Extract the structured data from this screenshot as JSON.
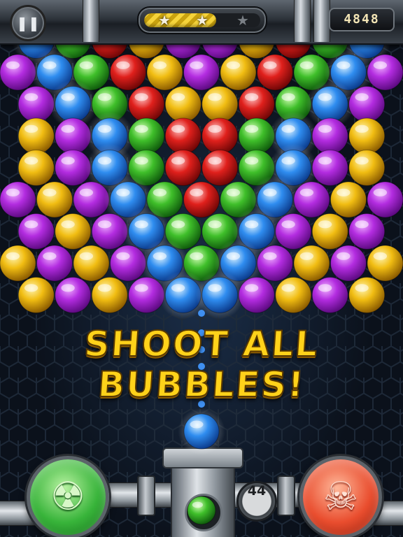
{
  "hud": {
    "pause_icon": "pause-icon",
    "pause_glyph": "❚❚",
    "stars": [
      "★",
      "★",
      "★"
    ],
    "stars_earned": 2,
    "progress": 0.62,
    "score": "4848"
  },
  "headline": {
    "line1": "SHOOT ALL",
    "line2": "BUBBLES!"
  },
  "launcher": {
    "current_bubble_color": "blue",
    "next_bubble_color": "green",
    "shots_left": "44"
  },
  "powerups": {
    "left": {
      "icon": "radiation-icon",
      "glyph": "☢",
      "color": "#3fb43c"
    },
    "right": {
      "icon": "skull-icon",
      "glyph": "☠",
      "color": "#e84a2c"
    }
  },
  "colors": {
    "purple": [
      "#f0b0ff",
      "#b32ce0",
      "#5c0a80"
    ],
    "blue": [
      "#dff4ff",
      "#2f8df0",
      "#0b3b8c"
    ],
    "green": [
      "#d6ffb8",
      "#3fbf2a",
      "#0f5a0c"
    ],
    "red": [
      "#ffc2c2",
      "#e0201c",
      "#6e0606"
    ],
    "yellow": [
      "#fff4b0",
      "#f1bd12",
      "#8a5a00"
    ]
  },
  "bubble_grid": {
    "rows": [
      "BGRYPPYRGB",
      "PBGRYPYRGBP",
      "PBGRYYRGBP",
      "YPBGRRGBPY",
      "YPBGRRGBPY",
      "PYPBGRGBPYP",
      "PYPBGGBPYP",
      "YPYPBGBPYPY",
      "YPYPBBPYPY"
    ]
  }
}
